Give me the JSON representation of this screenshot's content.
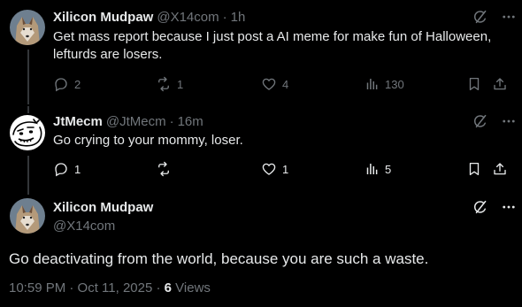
{
  "tweets": [
    {
      "name": "Xilicon Mudpaw",
      "handle": "@X14com",
      "time": "1h",
      "text_line1": "Get mass report because I just post a AI meme for make fun of Halloween,",
      "text_line2": "lefturds are losers.",
      "replies": "2",
      "reposts": "1",
      "likes": "4",
      "views": "130"
    },
    {
      "name": "JtMecm",
      "handle": "@JtMecm",
      "time": "16m",
      "text_line1": "Go crying to your mommy, loser.",
      "replies": "1",
      "reposts": "",
      "likes": "1",
      "views": "5"
    }
  ],
  "main": {
    "name": "Xilicon Mudpaw",
    "handle": "@X14com",
    "text": "Go deactivating from the world, because you are such a waste.",
    "timestamp": "10:59 PM · Oct 11, 2025 · ",
    "views_count": "6",
    "views_label": " Views"
  },
  "separator_dot": "·",
  "icons": {
    "grok": "grok-icon",
    "more": "more-icon",
    "reply": "reply-icon",
    "repost": "repost-icon",
    "like": "like-icon",
    "views": "views-icon",
    "bookmark": "bookmark-icon",
    "share": "share-icon"
  },
  "colors": {
    "background": "#000000",
    "text": "#e7e9ea",
    "muted": "#71767b",
    "line": "#333639"
  }
}
